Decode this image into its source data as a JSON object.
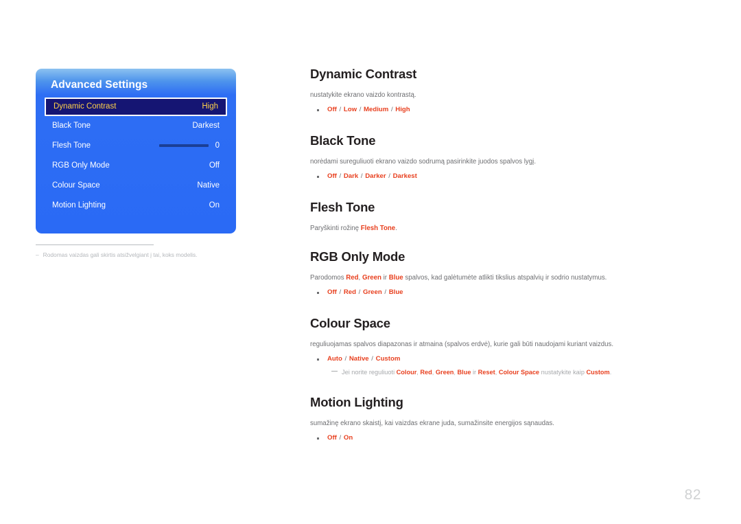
{
  "osd": {
    "title": "Advanced Settings",
    "rows": [
      {
        "label": "Dynamic Contrast",
        "value": "High",
        "selected": true,
        "slider": false
      },
      {
        "label": "Black Tone",
        "value": "Darkest",
        "selected": false,
        "slider": false
      },
      {
        "label": "Flesh Tone",
        "value": "0",
        "selected": false,
        "slider": true
      },
      {
        "label": "RGB Only Mode",
        "value": "Off",
        "selected": false,
        "slider": false
      },
      {
        "label": "Colour Space",
        "value": "Native",
        "selected": false,
        "slider": false
      },
      {
        "label": "Motion Lighting",
        "value": "On",
        "selected": false,
        "slider": false
      }
    ],
    "footnote_dash": "‒",
    "footnote": "Rodomas vaizdas gali skirtis atsižvelgiant į tai, koks modelis."
  },
  "sections": {
    "dynamic_contrast": {
      "title": "Dynamic Contrast",
      "desc": "nustatykite ekrano vaizdo kontrastą.",
      "options": [
        "Off",
        "Low",
        "Medium",
        "High"
      ]
    },
    "black_tone": {
      "title": "Black Tone",
      "desc": "norėdami sureguliuoti ekrano vaizdo sodrumą pasirinkite juodos spalvos lygį.",
      "options": [
        "Off",
        "Dark",
        "Darker",
        "Darkest"
      ]
    },
    "flesh_tone": {
      "title": "Flesh Tone",
      "desc_pre": "Paryškinti rožinę ",
      "desc_term": "Flesh Tone",
      "desc_post": "."
    },
    "rgb_only_mode": {
      "title": "RGB Only Mode",
      "desc_a": "Parodomos ",
      "desc_t1": "Red",
      "desc_b": ", ",
      "desc_t2": "Green",
      "desc_c": " ir ",
      "desc_t3": "Blue",
      "desc_d": " spalvos, kad galėtumėte atlikti tikslius atspalvių ir sodrio nustatymus.",
      "options": [
        "Off",
        "Red",
        "Green",
        "Blue"
      ]
    },
    "colour_space": {
      "title": "Colour Space",
      "desc": "reguliuojamas spalvos diapazonas ir atmaina (spalvos erdvė), kurie gali būti naudojami kuriant vaizdus.",
      "options": [
        "Auto",
        "Native",
        "Custom"
      ],
      "note": {
        "a": "Jei norite reguliuoti ",
        "t1": "Colour",
        "b": ", ",
        "t2": "Red",
        "c": ", ",
        "t3": "Green",
        "d": ", ",
        "t4": "Blue",
        "e": " ir ",
        "t5": "Reset",
        "f": ", ",
        "t6": "Colour Space",
        "g": " nustatykite kaip ",
        "t7": "Custom",
        "h": "."
      }
    },
    "motion_lighting": {
      "title": "Motion Lighting",
      "desc": "sumažinę ekrano skaistį, kai vaizdas ekrane juda, sumažinsite energijos sąnaudas.",
      "options": [
        "Off",
        "On"
      ]
    }
  },
  "page": {
    "number": "82"
  },
  "colors": {
    "osd_blue": "#2a6af5",
    "osd_selected_bg": "#151573",
    "osd_selected_text": "#ffd24a",
    "accent_red": "#e8401f",
    "body_gray": "#6d6e71",
    "heading_black": "#231f20",
    "note_gray": "#a7a9ac"
  }
}
